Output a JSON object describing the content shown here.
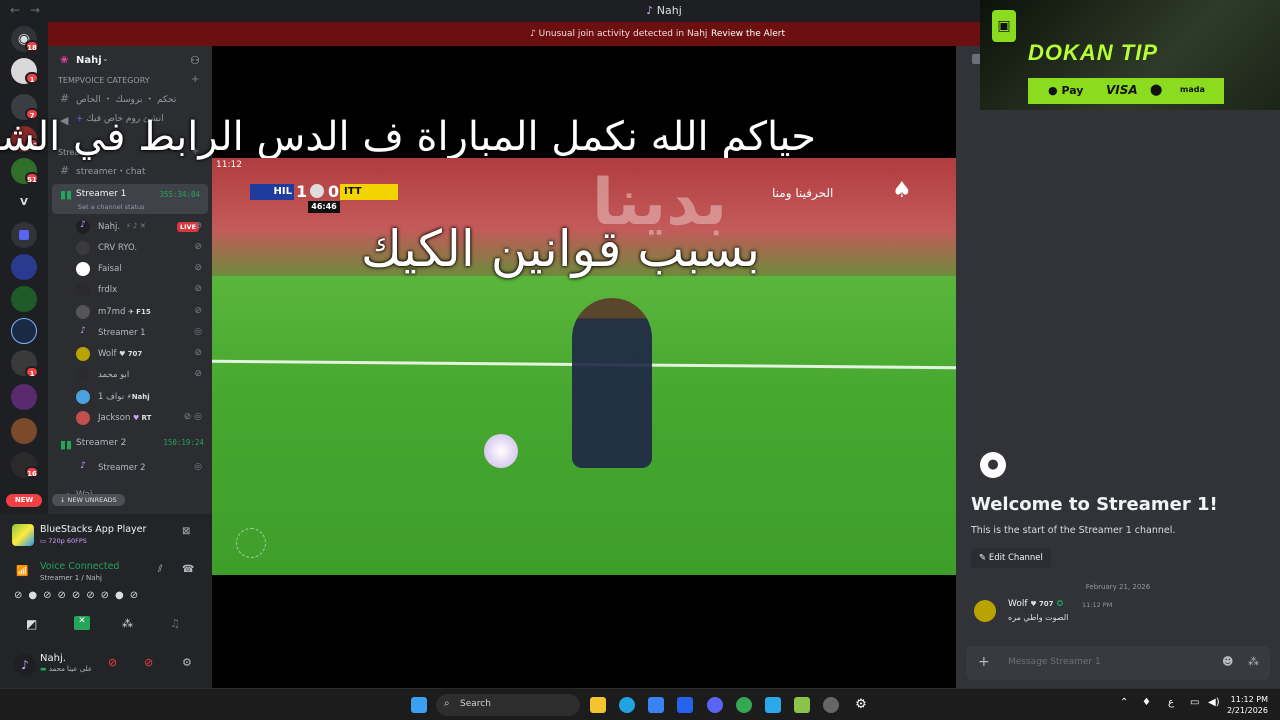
{
  "window": {
    "title": "Nahj"
  },
  "alert": {
    "message": "Unusual join activity detected in Nahj",
    "action": "Review the Alert"
  },
  "server_badges": [
    "18",
    "1",
    "7",
    "15",
    "51",
    "1",
    "16"
  ],
  "server_initial": "V",
  "new_label": "NEW",
  "guild": {
    "name": "Nahj"
  },
  "channels": {
    "category_temp": "TEMPVOICE CATEGORY",
    "temp_1": "تحكم ・ بروسك ・ الخاص",
    "temp_2": "انشئ روم خاص فيك",
    "category_streams": "Streams",
    "chat": "streamer・chat",
    "streamer1": {
      "name": "Streamer 1",
      "timer": "355:34:04",
      "status": "Set a channel status"
    },
    "streamer1_users": [
      {
        "name": "Nahj.",
        "tag": "",
        "live": "LIVE"
      },
      {
        "name": "CRV RYO.",
        "tag": ""
      },
      {
        "name": "Faisal",
        "tag": ""
      },
      {
        "name": "frdlx",
        "tag": ""
      },
      {
        "name": "m7md",
        "tag": "F15"
      },
      {
        "name": "Streamer 1",
        "tag": ""
      },
      {
        "name": "Wolf",
        "tag": "707"
      },
      {
        "name": "ابو محمد",
        "tag": ""
      },
      {
        "name": "نواف 1",
        "tag": "Nahj"
      },
      {
        "name": "Jackson",
        "tag": "RT"
      }
    ],
    "streamer2": {
      "name": "Streamer 2",
      "timer": "150:19:24"
    },
    "streamer2_users": [
      {
        "name": "Streamer 2",
        "tag": ""
      }
    ],
    "waiting": "Wai...",
    "new_unreads": "NEW UNREADS"
  },
  "activity": {
    "app": "BlueStacks App Player",
    "quality": "720p 60FPS"
  },
  "voice": {
    "status": "Voice Connected",
    "channel": "Streamer 1 / Nahj"
  },
  "user": {
    "name": "Nahj.",
    "status": "على عينا محمد"
  },
  "stream": {
    "overlay_line1": "حياكم الله نكمل المباراة ف الدس الرابط في الشات",
    "overlay_line2": "بسبب قوانين الكيك",
    "time": "11:12",
    "team1": "HIL",
    "score1": "1",
    "score2": "0",
    "team2": "ITT",
    "clock": "46:46",
    "banner_text": "الحرفينا ومنا",
    "banner_big": "بدينا"
  },
  "chat": {
    "welcome_title": "Welcome to Streamer 1!",
    "welcome_sub": "This is the start of the Streamer 1 channel.",
    "edit_channel": "Edit Channel",
    "date_divider": "February 21, 2026",
    "message": {
      "author": "Wolf",
      "tag": "707",
      "time": "11:12 PM",
      "text": "الصوت واطي مره"
    },
    "input_placeholder": "Message Streamer 1"
  },
  "ad": {
    "brand": "DOKAN TIP",
    "pay_methods": [
      "Pay",
      "VISA",
      "mada"
    ]
  },
  "taskbar": {
    "search": "Search",
    "lang": "ع",
    "time": "11:12 PM",
    "date": "2/21/2026"
  },
  "colors": {
    "accent": "#5865f2",
    "live": "#da373c",
    "online": "#23a55a",
    "alert_bg": "#6b0f10",
    "ad_green": "#8bdc1f"
  }
}
